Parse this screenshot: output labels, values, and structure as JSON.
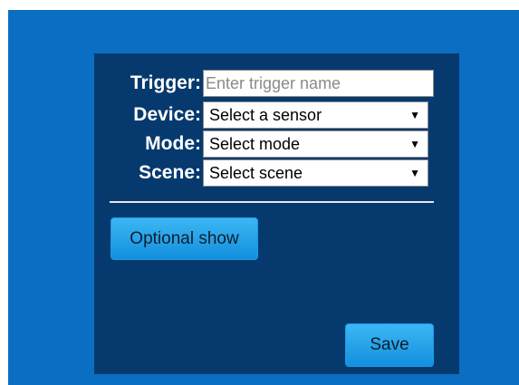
{
  "form": {
    "trigger": {
      "label": "Trigger:",
      "placeholder": "Enter trigger name",
      "value": ""
    },
    "device": {
      "label": "Device:",
      "selected": "Select a sensor"
    },
    "mode": {
      "label": "Mode:",
      "selected": "Select mode"
    },
    "scene": {
      "label": "Scene:",
      "selected": "Select scene"
    }
  },
  "buttons": {
    "optional_label": "Optional show",
    "save_label": "Save"
  },
  "icons": {
    "dropdown_arrow": "▼"
  },
  "colors": {
    "outer_background": "#0a6ec2",
    "panel_background": "#063a6e",
    "button_accent": "#3cb6f2"
  }
}
